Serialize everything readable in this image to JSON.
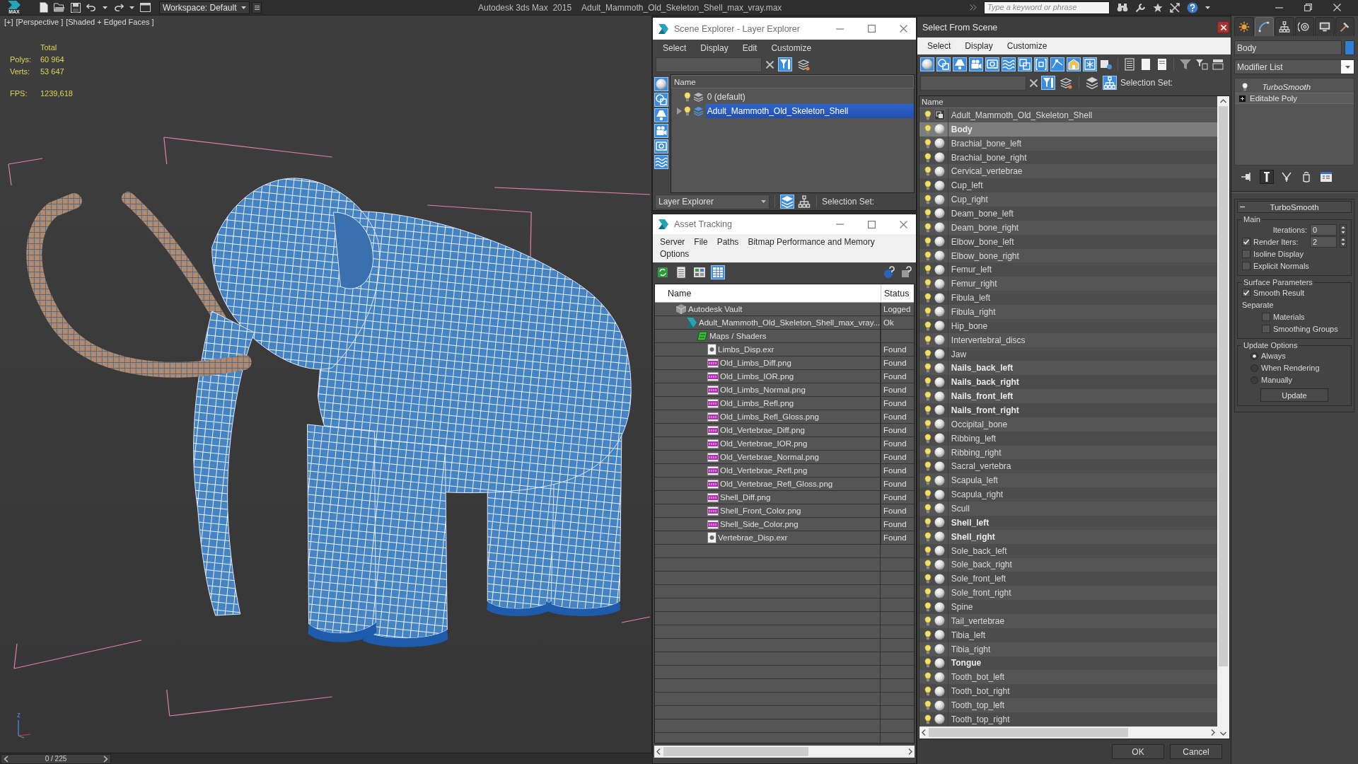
{
  "title_bar": {
    "logo_text": "MAX",
    "workspace": "Workspace: Default",
    "app_name": "Autodesk 3ds Max  2015",
    "file_name": "Adult_Mammoth_Old_Skeleton_Shell_max_vray.max",
    "search": {
      "placeholder": "Type a keyword or phrase"
    }
  },
  "viewport": {
    "menus": [
      "[+]",
      "[Perspective ]",
      "[Shaded + Edged Faces ]"
    ],
    "stats": {
      "heading": "Total",
      "rows": [
        {
          "label": "Polys:",
          "value": "60 964"
        },
        {
          "label": "Verts:",
          "value": "53 647"
        }
      ],
      "fps": {
        "label": "FPS:",
        "value": "1239,618"
      }
    },
    "axis_label": "z",
    "time_slider": {
      "position": "0 / 225",
      "level": 0
    }
  },
  "scene_explorer": {
    "title": "Scene Explorer - Layer Explorer",
    "menu": [
      "Select",
      "Display",
      "Edit",
      "Customize"
    ],
    "search_tools": [
      {
        "kind": "filter",
        "on": true
      },
      {
        "kind": "layer-filter",
        "on": false
      }
    ],
    "display_filters": [
      {
        "kind": "geometry",
        "on": true
      },
      {
        "kind": "shape",
        "on": true
      },
      {
        "kind": "light",
        "on": true
      },
      {
        "kind": "camera",
        "on": true
      },
      {
        "kind": "helper",
        "on": true
      },
      {
        "kind": "spacewarp",
        "on": true
      }
    ],
    "column": "Name",
    "layers": [
      {
        "name": "0 (default)",
        "expandable": false,
        "current": false,
        "selected": false
      },
      {
        "name": "Adult_Mammoth_Old_Skeleton_Shell",
        "expandable": true,
        "current": true,
        "selected": true
      }
    ],
    "footer": {
      "explorer": "Layer Explorer",
      "view_modes": [
        {
          "kind": "layers",
          "on": true
        },
        {
          "kind": "hierarchy",
          "on": false
        }
      ],
      "selection_set": "Selection Set:"
    }
  },
  "asset_tracking": {
    "title": "Asset Tracking",
    "menu": [
      "Server",
      "File",
      "Paths",
      "Bitmap Performance and Memory",
      "Options"
    ],
    "views": [
      {
        "kind": "list",
        "on": false
      },
      {
        "kind": "thumbnails",
        "on": false
      },
      {
        "kind": "table",
        "on": true
      }
    ],
    "columns": [
      "Name",
      "Status"
    ],
    "tree": [
      {
        "name": "Autodesk Vault",
        "kind": "vault",
        "status": "Logged",
        "children": [
          {
            "name": "Adult_Mammoth_Old_Skeleton_Shell_max_vray...",
            "kind": "scene",
            "status": "Ok",
            "children": [
              {
                "name": "Maps / Shaders",
                "kind": "maps",
                "children": [
                  {
                    "name": "Limbs_Disp.exr",
                    "kind": "exr",
                    "status": "Found"
                  },
                  {
                    "name": "Old_Limbs_Diff.png",
                    "kind": "png",
                    "status": "Found"
                  },
                  {
                    "name": "Old_Limbs_IOR.png",
                    "kind": "png",
                    "status": "Found"
                  },
                  {
                    "name": "Old_Limbs_Normal.png",
                    "kind": "png",
                    "status": "Found"
                  },
                  {
                    "name": "Old_Limbs_Refl.png",
                    "kind": "png",
                    "status": "Found"
                  },
                  {
                    "name": "Old_Limbs_Refl_Gloss.png",
                    "kind": "png",
                    "status": "Found"
                  },
                  {
                    "name": "Old_Vertebrae_Diff.png",
                    "kind": "png",
                    "status": "Found"
                  },
                  {
                    "name": "Old_Vertebrae_IOR.png",
                    "kind": "png",
                    "status": "Found"
                  },
                  {
                    "name": "Old_Vertebrae_Normal.png",
                    "kind": "png",
                    "status": "Found"
                  },
                  {
                    "name": "Old_Vertebrae_Refl.png",
                    "kind": "png",
                    "status": "Found"
                  },
                  {
                    "name": "Old_Vertebrae_Refl_Gloss.png",
                    "kind": "png",
                    "status": "Found"
                  },
                  {
                    "name": "Shell_Diff.png",
                    "kind": "png",
                    "status": "Found"
                  },
                  {
                    "name": "Shell_Front_Color.png",
                    "kind": "png",
                    "status": "Found"
                  },
                  {
                    "name": "Shell_Side_Color.png",
                    "kind": "png",
                    "status": "Found"
                  },
                  {
                    "name": "Vertebrae_Disp.exr",
                    "kind": "exr",
                    "status": "Found"
                  }
                ]
              }
            ]
          }
        ]
      }
    ]
  },
  "select_from_scene": {
    "title": "Select From Scene",
    "menu": [
      "Select",
      "Display",
      "Customize"
    ],
    "display_filters": [
      {
        "kind": "geometry",
        "on": true
      },
      {
        "kind": "shape",
        "on": true
      },
      {
        "kind": "light",
        "on": true
      },
      {
        "kind": "camera",
        "on": true
      },
      {
        "kind": "helper",
        "on": true
      },
      {
        "kind": "spacewarp",
        "on": true
      },
      {
        "kind": "group",
        "on": true
      },
      {
        "kind": "xref",
        "on": true
      },
      {
        "kind": "bone",
        "on": true
      },
      {
        "kind": "container",
        "on": true
      },
      {
        "kind": "frozen",
        "on": true
      },
      {
        "kind": "hidden",
        "on": false
      }
    ],
    "search_tools": [
      {
        "kind": "filter",
        "on": true
      },
      {
        "kind": "layer-filter",
        "on": false
      }
    ],
    "view_modes": [
      {
        "kind": "layers",
        "on": false
      },
      {
        "kind": "hierarchy",
        "on": true
      }
    ],
    "selection_set": "Selection Set:",
    "column": "Name",
    "objects": [
      {
        "name": "Adult_Mammoth_Old_Skeleton_Shell",
        "kind": "group",
        "bold": false,
        "selected": false
      },
      {
        "name": "Body",
        "kind": "geometry",
        "bold": true,
        "selected": true
      },
      {
        "name": "Brachial_bone_left",
        "kind": "geometry",
        "bold": false,
        "selected": false
      },
      {
        "name": "Brachial_bone_right",
        "kind": "geometry",
        "bold": false,
        "selected": false
      },
      {
        "name": "Cervical_vertebrae",
        "kind": "geometry",
        "bold": false,
        "selected": false
      },
      {
        "name": "Cup_left",
        "kind": "geometry",
        "bold": false,
        "selected": false
      },
      {
        "name": "Cup_right",
        "kind": "geometry",
        "bold": false,
        "selected": false
      },
      {
        "name": "Deam_bone_left",
        "kind": "geometry",
        "bold": false,
        "selected": false
      },
      {
        "name": "Deam_bone_right",
        "kind": "geometry",
        "bold": false,
        "selected": false
      },
      {
        "name": "Elbow_bone_left",
        "kind": "geometry",
        "bold": false,
        "selected": false
      },
      {
        "name": "Elbow_bone_right",
        "kind": "geometry",
        "bold": false,
        "selected": false
      },
      {
        "name": "Femur_left",
        "kind": "geometry",
        "bold": false,
        "selected": false
      },
      {
        "name": "Femur_right",
        "kind": "geometry",
        "bold": false,
        "selected": false
      },
      {
        "name": "Fibula_left",
        "kind": "geometry",
        "bold": false,
        "selected": false
      },
      {
        "name": "Fibula_right",
        "kind": "geometry",
        "bold": false,
        "selected": false
      },
      {
        "name": "Hip_bone",
        "kind": "geometry",
        "bold": false,
        "selected": false
      },
      {
        "name": "Intervertebral_discs",
        "kind": "geometry",
        "bold": false,
        "selected": false
      },
      {
        "name": "Jaw",
        "kind": "geometry",
        "bold": false,
        "selected": false
      },
      {
        "name": "Nails_back_left",
        "kind": "geometry",
        "bold": true,
        "selected": false
      },
      {
        "name": "Nails_back_right",
        "kind": "geometry",
        "bold": true,
        "selected": false
      },
      {
        "name": "Nails_front_left",
        "kind": "geometry",
        "bold": true,
        "selected": false
      },
      {
        "name": "Nails_front_right",
        "kind": "geometry",
        "bold": true,
        "selected": false
      },
      {
        "name": "Occipital_bone",
        "kind": "geometry",
        "bold": false,
        "selected": false
      },
      {
        "name": "Ribbing_left",
        "kind": "geometry",
        "bold": false,
        "selected": false
      },
      {
        "name": "Ribbing_right",
        "kind": "geometry",
        "bold": false,
        "selected": false
      },
      {
        "name": "Sacral_vertebra",
        "kind": "geometry",
        "bold": false,
        "selected": false
      },
      {
        "name": "Scapula_left",
        "kind": "geometry",
        "bold": false,
        "selected": false
      },
      {
        "name": "Scapula_right",
        "kind": "geometry",
        "bold": false,
        "selected": false
      },
      {
        "name": "Scull",
        "kind": "geometry",
        "bold": false,
        "selected": false
      },
      {
        "name": "Shell_left",
        "kind": "geometry",
        "bold": true,
        "selected": false
      },
      {
        "name": "Shell_right",
        "kind": "geometry",
        "bold": true,
        "selected": false
      },
      {
        "name": "Sole_back_left",
        "kind": "geometry",
        "bold": false,
        "selected": false
      },
      {
        "name": "Sole_back_right",
        "kind": "geometry",
        "bold": false,
        "selected": false
      },
      {
        "name": "Sole_front_left",
        "kind": "geometry",
        "bold": false,
        "selected": false
      },
      {
        "name": "Sole_front_right",
        "kind": "geometry",
        "bold": false,
        "selected": false
      },
      {
        "name": "Spine",
        "kind": "geometry",
        "bold": false,
        "selected": false
      },
      {
        "name": "Tail_vertebrae",
        "kind": "geometry",
        "bold": false,
        "selected": false
      },
      {
        "name": "Tibia_left",
        "kind": "geometry",
        "bold": false,
        "selected": false
      },
      {
        "name": "Tibia_right",
        "kind": "geometry",
        "bold": false,
        "selected": false
      },
      {
        "name": "Tongue",
        "kind": "geometry",
        "bold": true,
        "selected": false
      },
      {
        "name": "Tooth_bot_left",
        "kind": "geometry",
        "bold": false,
        "selected": false
      },
      {
        "name": "Tooth_bot_right",
        "kind": "geometry",
        "bold": false,
        "selected": false
      },
      {
        "name": "Tooth_top_left",
        "kind": "geometry",
        "bold": false,
        "selected": false
      },
      {
        "name": "Tooth_top_right",
        "kind": "geometry",
        "bold": false,
        "selected": false
      }
    ],
    "buttons": [
      "OK",
      "Cancel"
    ]
  },
  "command_panel": {
    "tabs": [
      {
        "kind": "create",
        "selected": false
      },
      {
        "kind": "modify",
        "selected": true
      },
      {
        "kind": "hierarchy",
        "selected": false
      },
      {
        "kind": "motion",
        "selected": false
      },
      {
        "kind": "display",
        "selected": false
      },
      {
        "kind": "utilities",
        "selected": false
      }
    ],
    "object": {
      "name": "Body",
      "color": "#2f80d4"
    },
    "modifier_list": "Modifier List",
    "stack": [
      {
        "name": "TurboSmooth",
        "kind": "modifier"
      },
      {
        "name": "Editable Poly",
        "kind": "base"
      }
    ],
    "stack_tools": [
      {
        "kind": "pin",
        "on": false
      },
      {
        "kind": "end-result",
        "on": true
      },
      {
        "kind": "make-unique",
        "on": false
      },
      {
        "kind": "remove",
        "on": false
      },
      {
        "kind": "configure",
        "on": false
      }
    ],
    "rollout": {
      "title": "TurboSmooth",
      "expanded": true,
      "groups": [
        {
          "title": "Main",
          "controls": [
            {
              "kind": "spinner",
              "label": "Iterations:",
              "value": "0"
            },
            {
              "kind": "check-spinner",
              "label": "Render Iters:",
              "checked": true,
              "value": "2"
            },
            {
              "kind": "checkbox",
              "label": "Isoline Display",
              "checked": false
            },
            {
              "kind": "checkbox",
              "label": "Explicit Normals",
              "checked": false
            }
          ]
        },
        {
          "title": "Surface Parameters",
          "controls": [
            {
              "kind": "checkbox",
              "label": "Smooth Result",
              "checked": true
            },
            {
              "kind": "label",
              "label": "Separate"
            },
            {
              "kind": "sub-checkbox",
              "label": "Materials",
              "checked": false
            },
            {
              "kind": "sub-checkbox",
              "label": "Smoothing Groups",
              "checked": false
            }
          ]
        },
        {
          "title": "Update Options",
          "controls": [
            {
              "kind": "radio",
              "label": "Always",
              "selected": true
            },
            {
              "kind": "radio",
              "label": "When Rendering",
              "selected": false
            },
            {
              "kind": "radio",
              "label": "Manually",
              "selected": false
            },
            {
              "kind": "button",
              "label": "Update"
            }
          ]
        }
      ]
    }
  }
}
